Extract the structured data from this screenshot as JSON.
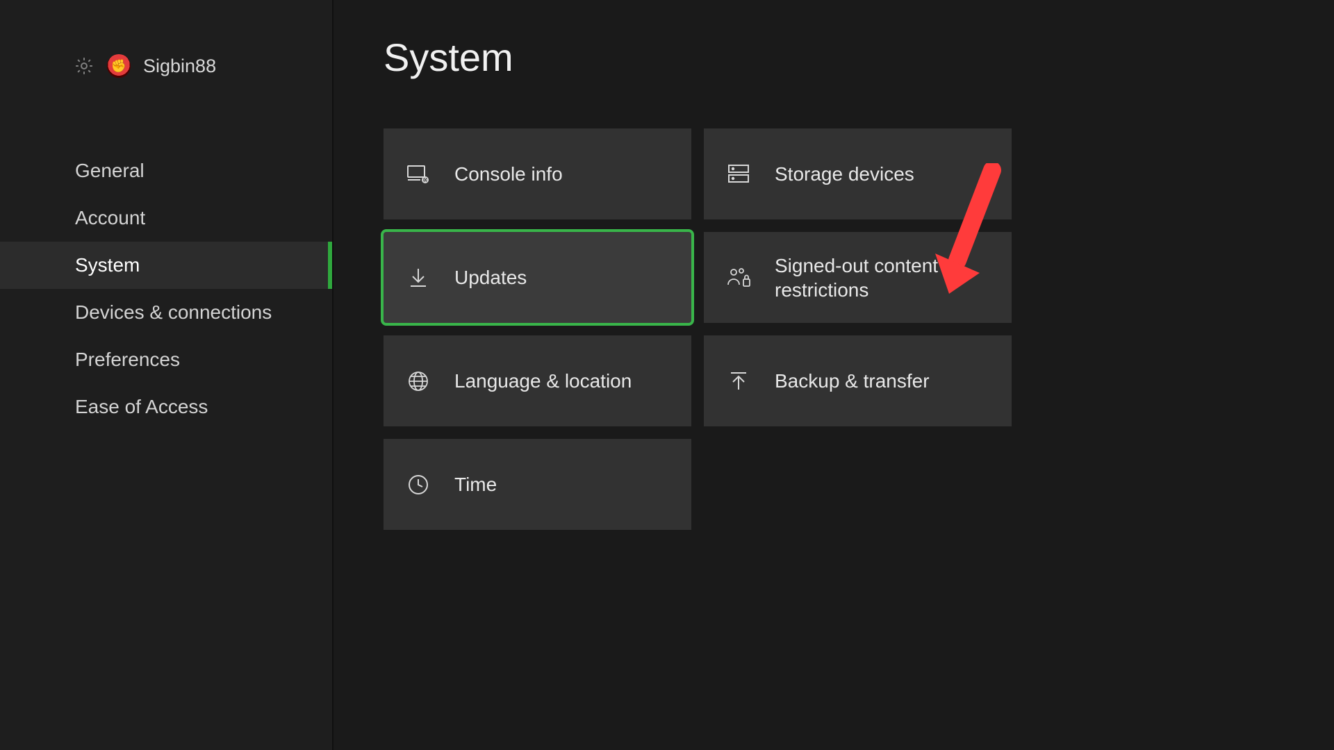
{
  "profile": {
    "username": "Sigbin88"
  },
  "page_title": "System",
  "sidebar": {
    "items": [
      {
        "label": "General"
      },
      {
        "label": "Account"
      },
      {
        "label": "System"
      },
      {
        "label": "Devices & connections"
      },
      {
        "label": "Preferences"
      },
      {
        "label": "Ease of Access"
      }
    ],
    "active_index": 2
  },
  "tiles": {
    "console_info": "Console info",
    "updates": "Updates",
    "language_location": "Language & location",
    "time": "Time",
    "storage_devices": "Storage devices",
    "signed_out_restrictions": "Signed-out content restrictions",
    "backup_transfer": "Backup & transfer"
  },
  "selected_tile": "updates",
  "colors": {
    "accent": "#39b54a",
    "tile_bg": "#323232",
    "bg": "#1a1a1a",
    "sidebar_bg": "#1e1e1e"
  }
}
